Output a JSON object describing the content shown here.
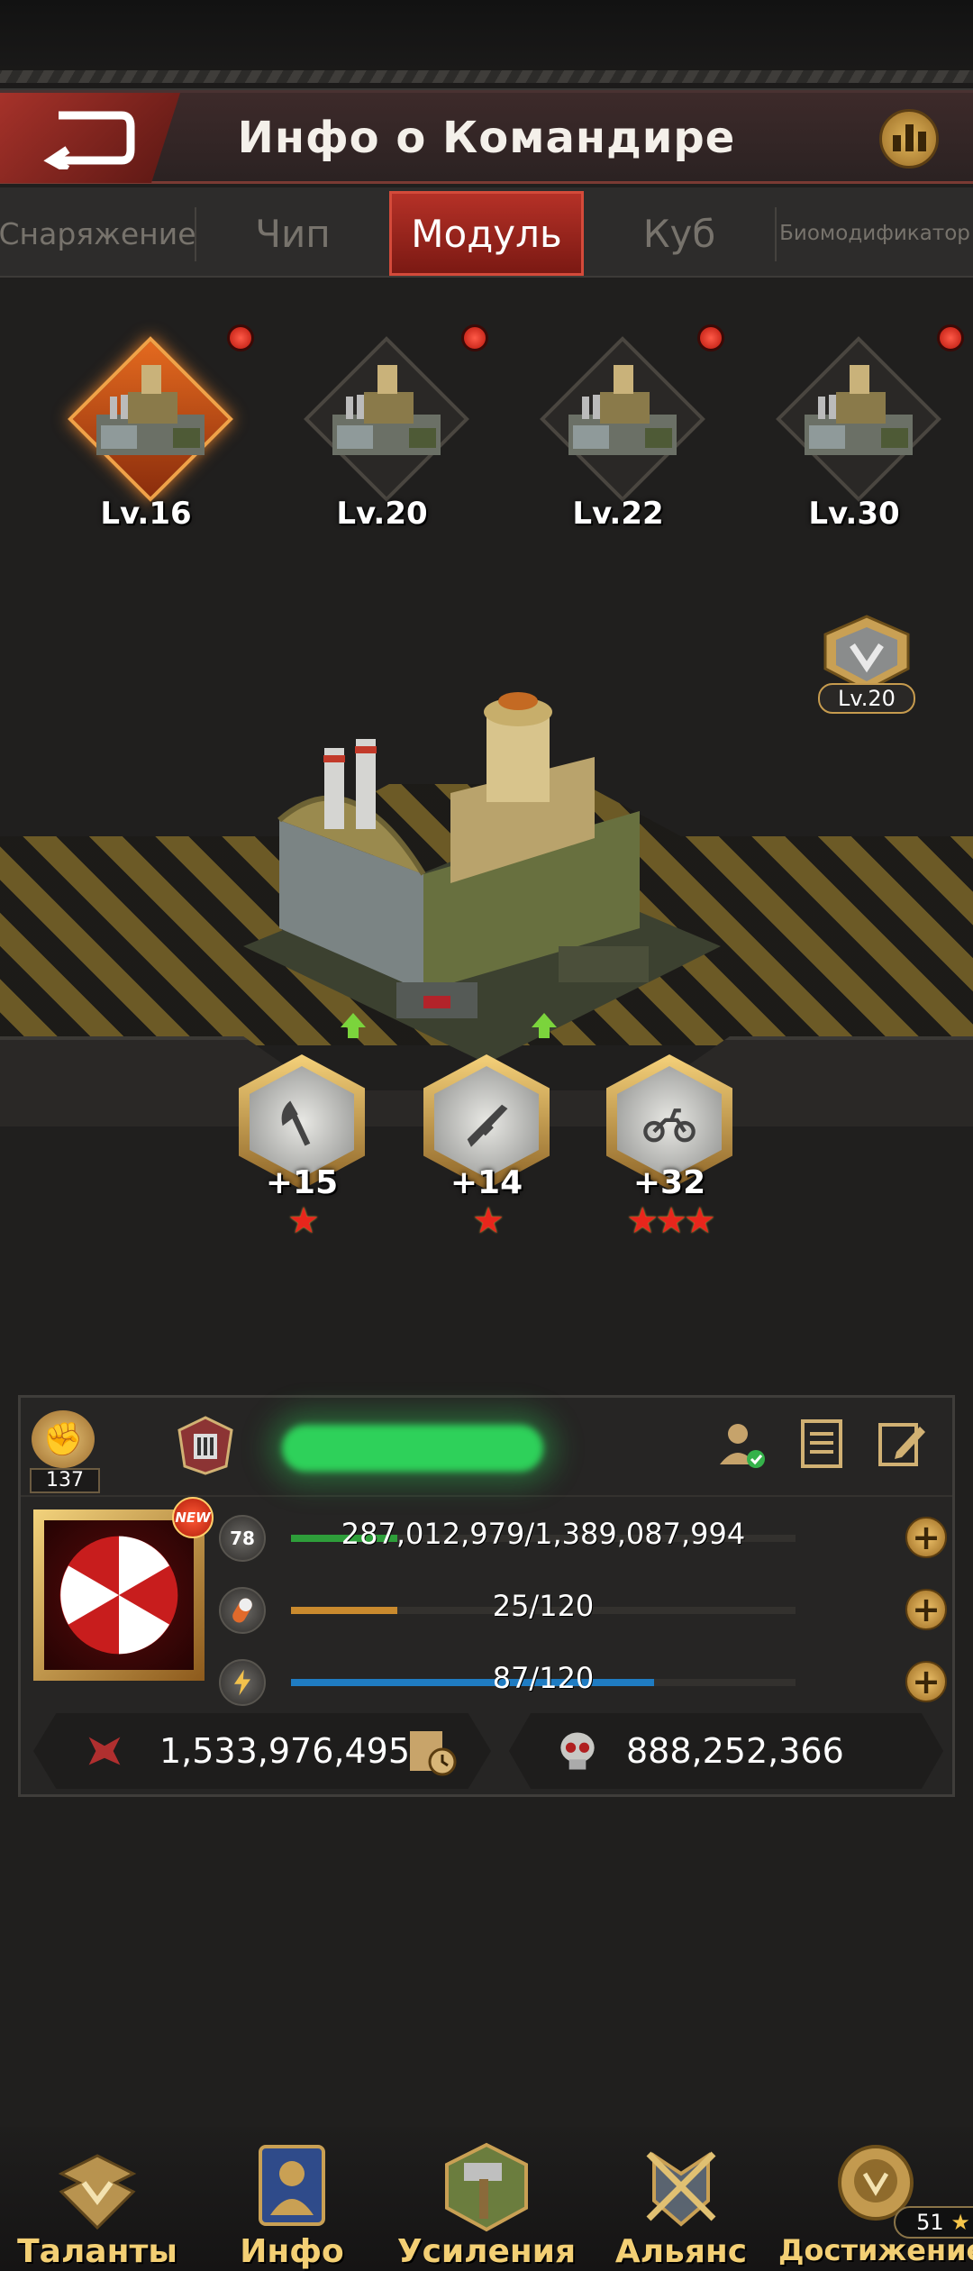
{
  "header": {
    "title": "Инфо о Командире"
  },
  "tabs": [
    {
      "label": "Снаряжение",
      "active": false
    },
    {
      "label": "Чип",
      "active": false
    },
    {
      "label": "Модуль",
      "active": true
    },
    {
      "label": "Куб",
      "active": false
    },
    {
      "label": "Биомодификатор",
      "active": false
    }
  ],
  "modules": [
    {
      "level": "Lv.16",
      "selected": true,
      "notification": true
    },
    {
      "level": "Lv.20",
      "selected": false,
      "notification": true
    },
    {
      "level": "Lv.22",
      "selected": false,
      "notification": true
    },
    {
      "level": "Lv.30",
      "selected": false,
      "notification": true
    }
  ],
  "rank_badge": {
    "level": "Lv.20"
  },
  "equipment": [
    {
      "icon": "axe-icon",
      "bonus": "+15",
      "stars": 1,
      "upgradable": true
    },
    {
      "icon": "rifle-icon",
      "bonus": "+14",
      "stars": 1,
      "upgradable": true
    },
    {
      "icon": "motorcycle-icon",
      "bonus": "+32",
      "stars": 3,
      "upgradable": false
    }
  ],
  "commander": {
    "fist_count": "137",
    "level": "78",
    "new_badge": "NEW",
    "experience": {
      "text": "287,012,979/1,389,087,994",
      "fraction": 0.21
    },
    "stamina": {
      "text": "25/120",
      "fraction": 0.21
    },
    "energy": {
      "text": "87/120",
      "fraction": 0.72
    },
    "power": "1,533,976,495",
    "kills": "888,252,366"
  },
  "nav": [
    {
      "label": "Таланты"
    },
    {
      "label": "Инфо"
    },
    {
      "label": "Усиления"
    },
    {
      "label": "Альянс"
    },
    {
      "label": "Достижение",
      "count": "51"
    }
  ],
  "colors": {
    "accent_red": "#b53127",
    "gold": "#f3cf74",
    "exp_bar": "#2e9e3a",
    "stamina_bar": "#c98a2e",
    "energy_bar": "#1f7cc2"
  }
}
